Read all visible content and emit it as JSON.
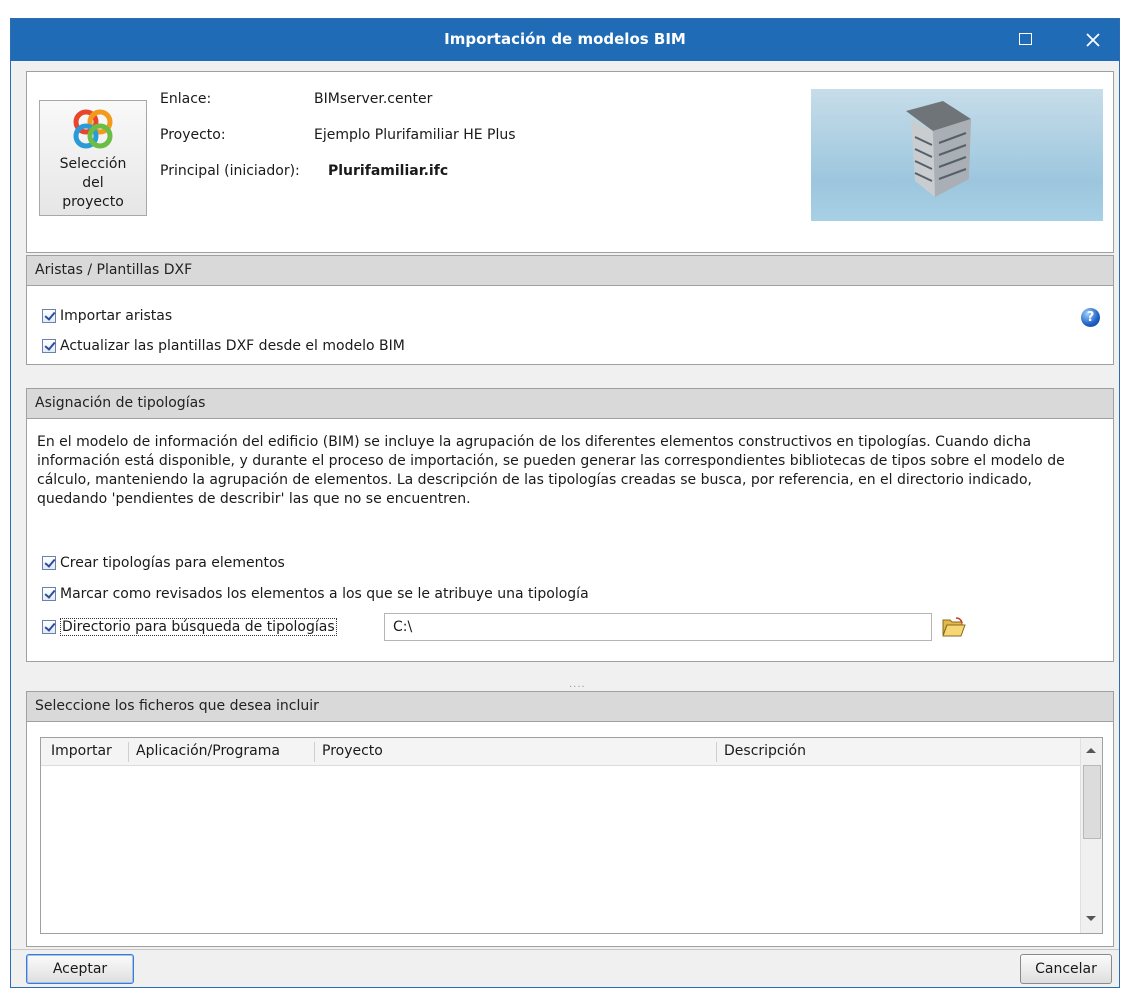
{
  "window": {
    "title": "Importación de modelos BIM"
  },
  "project": {
    "select_button_label": "Selección del proyecto",
    "link_label": "Enlace:",
    "link_value": "BIMserver.center",
    "project_label": "Proyecto:",
    "project_value": "Ejemplo Plurifamiliar HE Plus",
    "main_label": "Principal (iniciador):",
    "main_value": "Plurifamiliar.ifc"
  },
  "aristas": {
    "header": "Aristas / Plantillas DXF",
    "import_edges": {
      "label": "Importar aristas",
      "checked": true
    },
    "update_templates": {
      "label": "Actualizar las plantillas DXF desde el modelo BIM",
      "checked": true
    },
    "help_icon": "help-icon"
  },
  "tipologias": {
    "header": "Asignación de tipologías",
    "description": "En el modelo de información del edificio (BIM) se incluye la agrupación de los diferentes elementos constructivos en tipologías. Cuando dicha información está disponible, y durante el proceso de importación, se pueden generar las correspondientes bibliotecas de tipos sobre el modelo de cálculo, manteniendo la agrupación de elementos. La descripción de las tipologías creadas se busca, por referencia, en el directorio indicado, quedando 'pendientes de describir' las que no se encuentren.",
    "create": {
      "label": "Crear tipologías para elementos",
      "checked": true
    },
    "mark_reviewed": {
      "label": "Marcar como revisados los elementos a los que se le atribuye una tipología",
      "checked": true
    },
    "directory": {
      "label": "Directorio para búsqueda de tipologías",
      "checked": true,
      "value": "C:\\"
    }
  },
  "files": {
    "header": "Seleccione los ficheros que desea incluir",
    "columns": [
      "Importar",
      "Aplicación/Programa",
      "Proyecto",
      "Descripción"
    ],
    "rows": []
  },
  "buttons": {
    "accept": "Aceptar",
    "cancel": "Cancelar"
  },
  "colors": {
    "titlebar": "#1f6bb6",
    "panel_header": "#d9d9d9"
  }
}
